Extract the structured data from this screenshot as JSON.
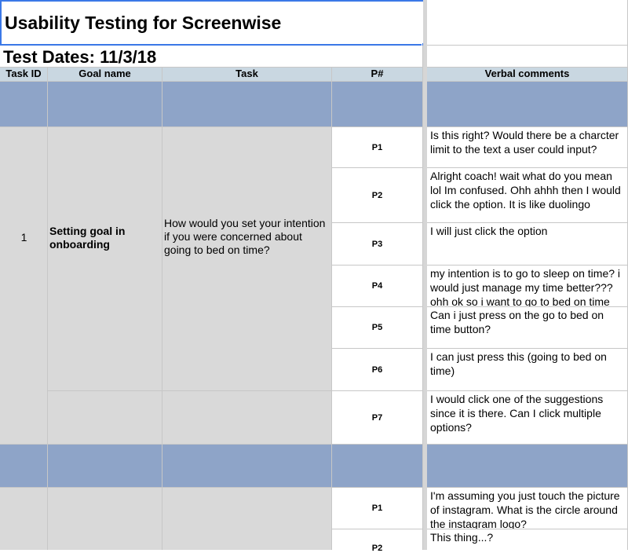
{
  "sheet": {
    "title": "Usability Testing for Screenwise",
    "subtitle": "Test Dates: 11/3/18"
  },
  "columns": {
    "task_id": "Task ID",
    "goal_name": "Goal name",
    "task": "Task",
    "participant": "P#",
    "verbal_comments": "Verbal comments"
  },
  "task1": {
    "id": "1",
    "goal": "Setting goal in onboarding",
    "task": "How would you set your intention if you were concerned about going to bed on time?",
    "rows": [
      {
        "p": "P1",
        "comment": "Is this right? Would there be a charcter limit to the text a user could input?"
      },
      {
        "p": "P2",
        "comment": "Alright coach! wait what do you mean lol Im confused. Ohh ahhh then I would click the option. It is like duolingo"
      },
      {
        "p": "P3",
        "comment": "I will just click the option"
      },
      {
        "p": "P4",
        "comment": "my intention is to go to sleep on time? i would just manage my time better??? ohh ok so i want to go to bed on time"
      },
      {
        "p": "P5",
        "comment": "Can i just press on the go to bed on time button?"
      },
      {
        "p": "P6",
        "comment": "I can just press this (going to bed on time)"
      },
      {
        "p": "P7",
        "comment": "I would click one of the suggestions since it is there. Can I click multiple options?"
      }
    ]
  },
  "task2": {
    "rows": [
      {
        "p": "P1",
        "comment": "I'm assuming you just touch the picture of instagram. What is the circle around the instagram logo?"
      },
      {
        "p": "P2",
        "comment": "This thing...?"
      }
    ]
  }
}
